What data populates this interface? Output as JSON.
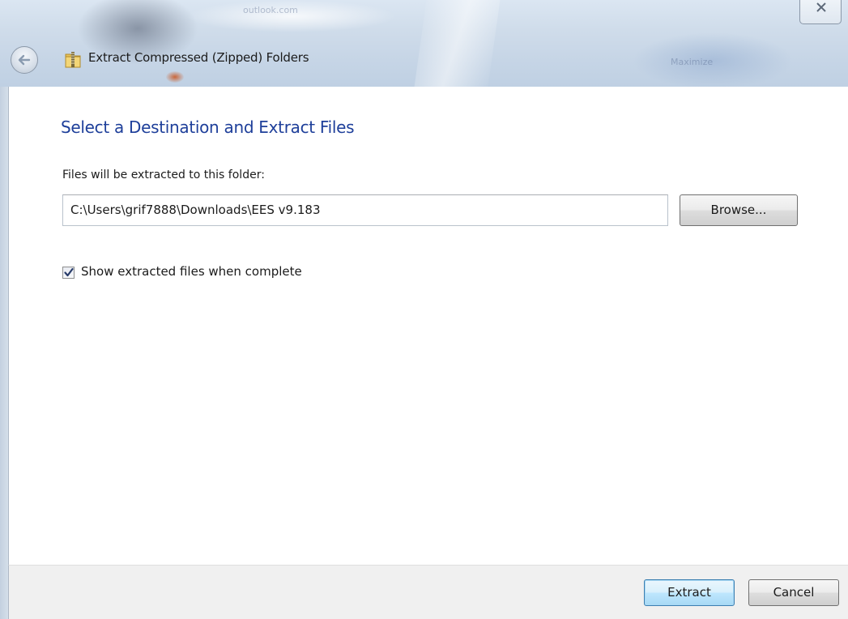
{
  "window": {
    "title": "Extract Compressed (Zipped) Folders",
    "accent_color": "#1e3f9a",
    "background_text_1": "outlook.com",
    "background_text_2": "Maximize"
  },
  "titlebar": {
    "back_icon": "back-arrow-icon",
    "app_icon": "zip-folder-icon",
    "close_icon": "close-icon"
  },
  "main": {
    "heading": "Select a Destination and Extract Files",
    "folder_label": "Files will be extracted to this folder:",
    "path_value": "C:\\Users\\grif7888\\Downloads\\EES v9.183",
    "browse_label": "Browse...",
    "show_files": {
      "checked": true,
      "label": "Show extracted files when complete"
    }
  },
  "footer": {
    "extract_label": "Extract",
    "cancel_label": "Cancel"
  }
}
